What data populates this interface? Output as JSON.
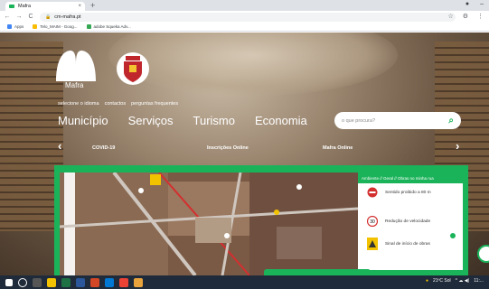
{
  "browser": {
    "tab_title": "Mafra",
    "tab_close": "×",
    "new_tab": "+",
    "nav": {
      "back": "←",
      "forward": "→",
      "reload": "C"
    },
    "url": "cm-mafra.pt",
    "bookmarks": [
      {
        "label": "Apps",
        "color": "#4285f4"
      },
      {
        "label": "Telo_MAIM - Goog...",
        "color": "#fbbc04"
      },
      {
        "label": "adobe Squeka Adv...",
        "color": "#34a853"
      }
    ]
  },
  "site": {
    "logo_text": "Mafra",
    "top_links": [
      "selecione o idioma",
      "contactos",
      "perguntas frequentes"
    ],
    "main_nav": [
      "Município",
      "Serviços",
      "Turismo",
      "Economia"
    ],
    "search_placeholder": "o que procura?",
    "quick_links": [
      "COVID-19",
      "Inscrições Online",
      "Mafra Online"
    ],
    "breadcrumb": "Ambiente // Geral // Obras no minha rua",
    "legend": [
      {
        "label": "Sentido proibido a 80 m",
        "sign": "no-entry"
      },
      {
        "label": "Redução de velocidade",
        "sign": "30"
      },
      {
        "label": "Sinal de início de obras",
        "sign": "works"
      }
    ],
    "colors": {
      "accent": "#1bb35a",
      "brand_red": "#c0272d"
    }
  },
  "taskbar": {
    "weather": "21ºC Sol",
    "time": "11:..."
  }
}
